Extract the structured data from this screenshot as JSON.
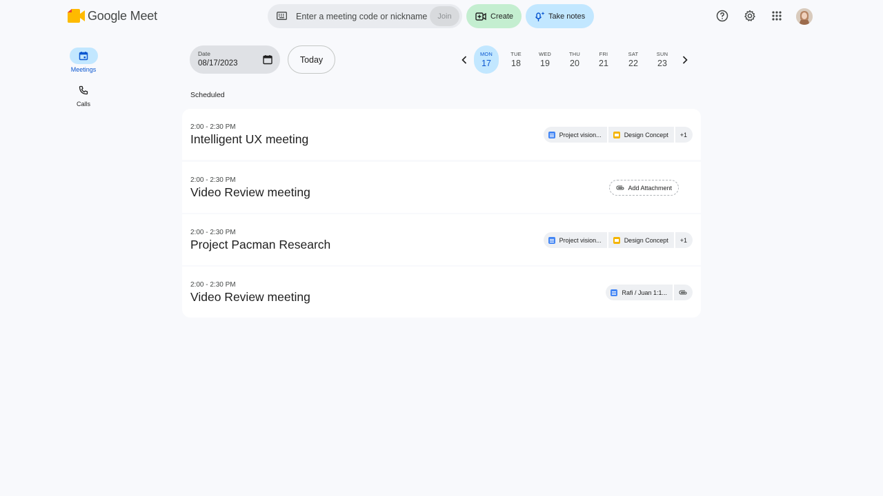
{
  "app": {
    "name": "Google Meet",
    "brand_word": "Google",
    "product_word": "Meet"
  },
  "header": {
    "search": {
      "placeholder": "Enter a meeting code or nickname",
      "value": ""
    },
    "join_label": "Join",
    "create_label": "Create",
    "notes_label": "Take notes",
    "icons": [
      "help-icon",
      "settings-icon",
      "apps-icon",
      "avatar"
    ]
  },
  "nav": {
    "items": [
      {
        "label": "Meetings",
        "icon": "calendar-icon",
        "active": true
      },
      {
        "label": "Calls",
        "icon": "phone-icon",
        "active": false
      }
    ]
  },
  "date_picker": {
    "label": "Date",
    "value": "08/17/2023",
    "today_label": "Today"
  },
  "week": {
    "days": [
      {
        "name": "MON",
        "num": "17",
        "active": true
      },
      {
        "name": "TUE",
        "num": "18"
      },
      {
        "name": "WED",
        "num": "19"
      },
      {
        "name": "THU",
        "num": "20"
      },
      {
        "name": "FRI",
        "num": "21"
      },
      {
        "name": "SAT",
        "num": "22"
      },
      {
        "name": "SUN",
        "num": "23"
      }
    ]
  },
  "section_title": "Scheduled",
  "meetings": [
    {
      "time": "2:00 - 2:30 PM",
      "title": "Intelligent UX meeting",
      "attachments": [
        {
          "label": "Project vision...",
          "type": "doc"
        },
        {
          "label": "Design Concept",
          "type": "slide"
        }
      ],
      "more": "+1"
    },
    {
      "time": "2:00 - 2:30 PM",
      "title": "Video Review meeting",
      "add_attachment": "Add Attachment"
    },
    {
      "time": "2:00 - 2:30 PM",
      "title": "Project Pacman Research",
      "attachments": [
        {
          "label": "Project vision...",
          "type": "doc"
        },
        {
          "label": "Design Concept",
          "type": "slide"
        }
      ],
      "more": "+1"
    },
    {
      "time": "2:00 - 2:30 PM",
      "title": "Video Review meeting",
      "attachments": [
        {
          "label": "Rafi / Juan 1:1...",
          "type": "doc"
        }
      ],
      "attach_icon": "attachment-icon"
    }
  ],
  "colors": {
    "accent": "#0b57d0",
    "create_bg": "#c4eed0",
    "notes_bg": "#c2e7ff",
    "page_bg": "#f8f9fc"
  }
}
